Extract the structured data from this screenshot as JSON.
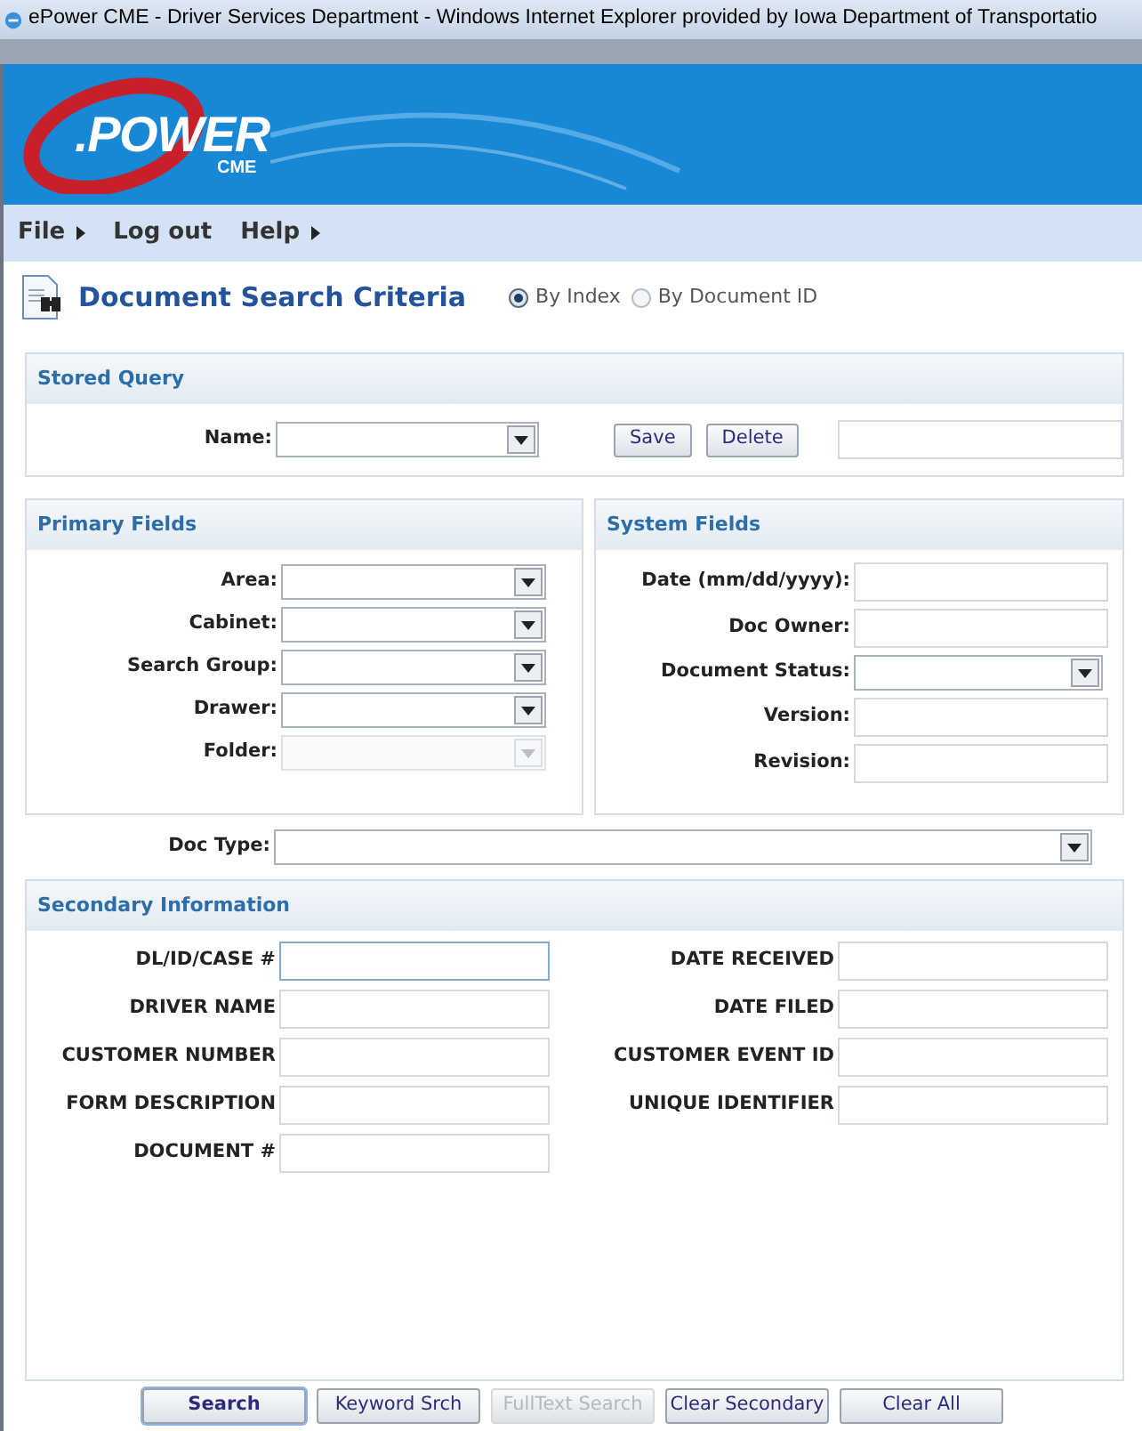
{
  "window": {
    "title": "ePower CME - Driver Services Department - Windows Internet Explorer provided by Iowa Department of Transportatio"
  },
  "banner": {
    "logo_text": ".POWER",
    "logo_sub": "CME"
  },
  "menu": [
    {
      "label": "File",
      "submenu": true
    },
    {
      "label": "Log out",
      "submenu": false
    },
    {
      "label": "Help",
      "submenu": true
    }
  ],
  "page_title": "Document Search Criteria",
  "search_mode": [
    {
      "label": "By Index",
      "selected": true
    },
    {
      "label": "By Document ID",
      "selected": false
    }
  ],
  "stored_query": {
    "title": "Stored Query",
    "name_label": "Name:",
    "buttons": [
      "Save",
      "Delete"
    ]
  },
  "primary_fields": {
    "title": "Primary Fields",
    "fields": [
      {
        "label": "Area:",
        "disabled": false
      },
      {
        "label": "Cabinet:",
        "disabled": false
      },
      {
        "label": "Search Group:",
        "disabled": false
      },
      {
        "label": "Drawer:",
        "disabled": false
      },
      {
        "label": "Folder:",
        "disabled": true
      }
    ]
  },
  "system_fields": {
    "title": "System Fields",
    "fields": [
      {
        "label": "Date (mm/dd/yyyy):",
        "kind": "text"
      },
      {
        "label": "Doc Owner:",
        "kind": "text"
      },
      {
        "label": "Document Status:",
        "kind": "select"
      },
      {
        "label": "Version:",
        "kind": "text"
      },
      {
        "label": "Revision:",
        "kind": "text"
      }
    ]
  },
  "doc_type": {
    "label": "Doc Type:"
  },
  "secondary": {
    "title": "Secondary Information",
    "left": [
      {
        "label": "DL/ID/CASE #",
        "focused": true
      },
      {
        "label": "DRIVER NAME",
        "focused": false
      },
      {
        "label": "CUSTOMER NUMBER",
        "focused": false
      },
      {
        "label": "FORM DESCRIPTION",
        "focused": false
      },
      {
        "label": "DOCUMENT #",
        "focused": false
      }
    ],
    "right": [
      {
        "label": "DATE RECEIVED",
        "focused": false
      },
      {
        "label": "DATE FILED",
        "focused": false
      },
      {
        "label": "CUSTOMER EVENT ID",
        "focused": false
      },
      {
        "label": "UNIQUE IDENTIFIER",
        "focused": false
      }
    ]
  },
  "actions": [
    {
      "label": "Search",
      "default": true,
      "disabled": false
    },
    {
      "label": "Keyword Srch",
      "default": false,
      "disabled": false
    },
    {
      "label": "FullText Search",
      "default": false,
      "disabled": true
    },
    {
      "label": "Clear Secondary",
      "default": false,
      "disabled": false
    },
    {
      "label": "Clear All",
      "default": false,
      "disabled": false
    }
  ]
}
